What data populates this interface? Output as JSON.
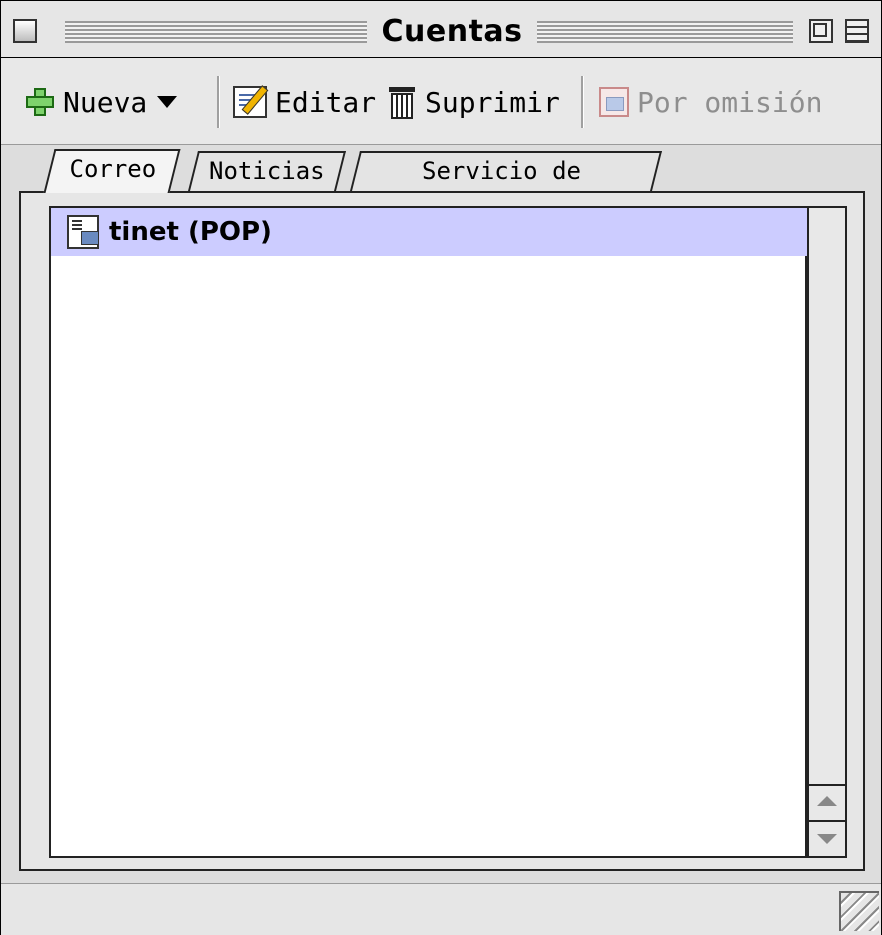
{
  "window": {
    "title": "Cuentas"
  },
  "toolbar": {
    "new_label": "Nueva",
    "edit_label": "Editar",
    "delete_label": "Suprimir",
    "default_label": "Por omisión"
  },
  "tabs": [
    {
      "label": "Correo",
      "active": true
    },
    {
      "label": "Noticias",
      "active": false
    },
    {
      "label": "Servicio de directorio",
      "active": false
    }
  ],
  "accounts": [
    {
      "label": "tinet (POP)",
      "selected": true
    }
  ],
  "colors": {
    "selection": "#ccccff",
    "chrome": "#e6e6e6"
  }
}
